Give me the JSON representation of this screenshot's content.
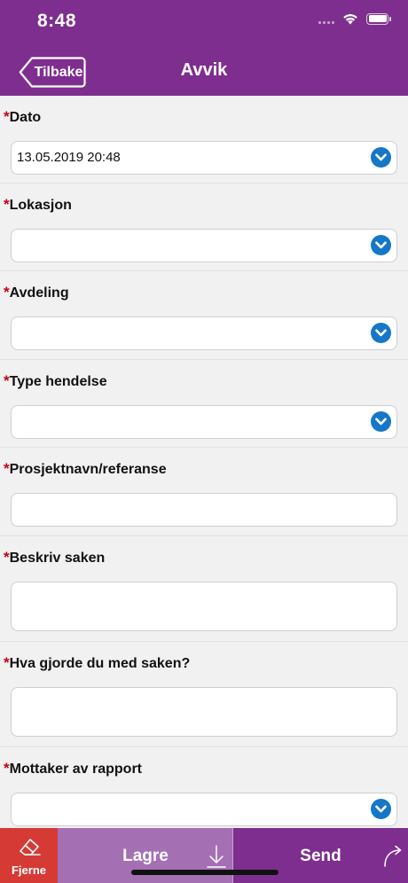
{
  "status_bar": {
    "time": "8:48",
    "battery_level": 1.0
  },
  "header": {
    "back_label": "Tilbake",
    "title": "Avvik",
    "background_color": "#7e2e8f"
  },
  "form": {
    "required_marker": "*",
    "fields": [
      {
        "label": "Dato",
        "value": "13.05.2019 20:48",
        "type": "dropdown"
      },
      {
        "label": "Lokasjon",
        "value": "",
        "type": "dropdown"
      },
      {
        "label": "Avdeling",
        "value": "",
        "type": "dropdown"
      },
      {
        "label": "Type hendelse",
        "value": "",
        "type": "dropdown"
      },
      {
        "label": "Prosjektnavn/referanse",
        "value": "",
        "type": "text"
      },
      {
        "label": "Beskriv saken",
        "value": "",
        "type": "textarea"
      },
      {
        "label": "Hva gjorde du med saken?",
        "value": "",
        "type": "textarea"
      },
      {
        "label": "Mottaker av rapport",
        "value": "",
        "type": "dropdown"
      }
    ]
  },
  "bottom_bar": {
    "remove_label": "Fjerne",
    "save_label": "Lagre",
    "send_label": "Send",
    "remove_color": "#d53a35",
    "save_color": "#a46fb3",
    "send_color": "#7e2e8f"
  },
  "icons": {
    "dropdown": "chevron-down-icon",
    "remove": "eraser-icon",
    "save": "download-arrow-icon",
    "send": "curved-arrow-icon"
  }
}
